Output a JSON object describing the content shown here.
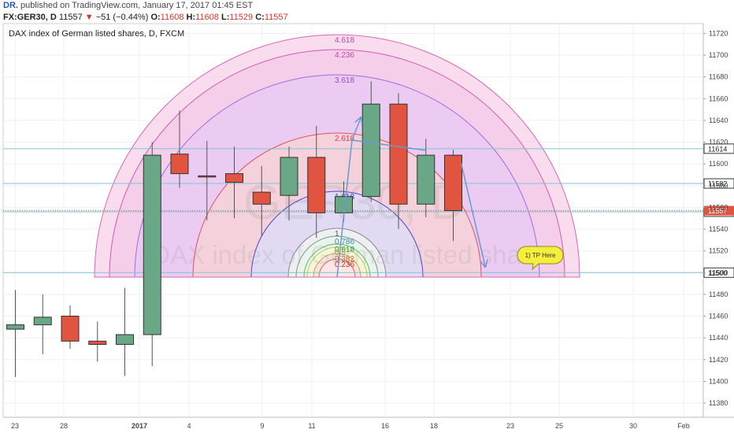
{
  "header": {
    "user": "DR.",
    "published": "published on TradingView.com, January 17, 2017 01:45 EST",
    "symbol": "FX:GER30, D",
    "price": "11557",
    "change": "−51 (−0.44%)",
    "o_label": "O:",
    "o": "11608",
    "h_label": "H:",
    "h": "11608",
    "l_label": "L:",
    "l": "11529",
    "c_label": "C:",
    "c": "11557",
    "colors": {
      "user": "#1e5bc6",
      "down": "#d0392b"
    }
  },
  "chart_data": {
    "type": "candlestick",
    "title": "DAX index of German listed shares, D, FXCM",
    "watermark_symbol": "GER30, D",
    "watermark_name": "DAX index of German listed shares",
    "x_tick_labels": [
      "23",
      "28",
      "2017",
      "4",
      "9",
      "11",
      "16",
      "18",
      "23",
      "25",
      "30",
      "Feb"
    ],
    "y_ticks": [
      11380,
      11400,
      11420,
      11440,
      11460,
      11480,
      11500,
      11520,
      11540,
      11560,
      11580,
      11600,
      11620,
      11640,
      11660,
      11680,
      11700,
      11720
    ],
    "ylim": [
      11367,
      11729
    ],
    "candles": [
      {
        "o": 11448,
        "h": 11484,
        "l": 11404,
        "c": 11452
      },
      {
        "o": 11452,
        "h": 11480,
        "l": 11425,
        "c": 11459
      },
      {
        "o": 11460,
        "h": 11470,
        "l": 11430,
        "c": 11437
      },
      {
        "o": 11437,
        "h": 11455,
        "l": 11418,
        "c": 11434
      },
      {
        "o": 11434,
        "h": 11486,
        "l": 11405,
        "c": 11443
      },
      {
        "o": 11443,
        "h": 11620,
        "l": 11414,
        "c": 11608
      },
      {
        "o": 11609,
        "h": 11649,
        "l": 11578,
        "c": 11591
      },
      {
        "o": 11589,
        "h": 11621,
        "l": 11548,
        "c": 11588
      },
      {
        "o": 11591,
        "h": 11616,
        "l": 11550,
        "c": 11583
      },
      {
        "o": 11574,
        "h": 11598,
        "l": 11534,
        "c": 11563
      },
      {
        "o": 11571,
        "h": 11616,
        "l": 11548,
        "c": 11606
      },
      {
        "o": 11606,
        "h": 11635,
        "l": 11532,
        "c": 11555
      },
      {
        "o": 11555,
        "h": 11584,
        "l": 11547,
        "c": 11570
      },
      {
        "o": 11570,
        "h": 11676,
        "l": 11565,
        "c": 11655
      },
      {
        "o": 11655,
        "h": 11665,
        "l": 11540,
        "c": 11563
      },
      {
        "o": 11563,
        "h": 11623,
        "l": 11551,
        "c": 11608
      },
      {
        "o": 11608,
        "h": 11613,
        "l": 11529,
        "c": 11557
      }
    ],
    "horizontal_levels": [
      {
        "value": 11614,
        "label": "11614"
      },
      {
        "value": 11582,
        "label": "11582"
      },
      {
        "value": 11556,
        "label": "11556"
      },
      {
        "value": 11500,
        "label": "11500"
      }
    ],
    "current_price": {
      "value": 11557,
      "label": "11557"
    },
    "fib_ratios": [
      "4.618",
      "4.236",
      "3.618",
      "2.618",
      "1.618",
      "1",
      "0.786",
      "0.618",
      "0.5",
      "0.382",
      "0.236"
    ],
    "annotation": "1) TP Here",
    "colors": {
      "up": "#6aa786",
      "down": "#e05440",
      "level": "#7fc4d6",
      "price_tag": "#e05440",
      "callout": "#f4ee3c",
      "arrow": "#6f98cf"
    }
  }
}
